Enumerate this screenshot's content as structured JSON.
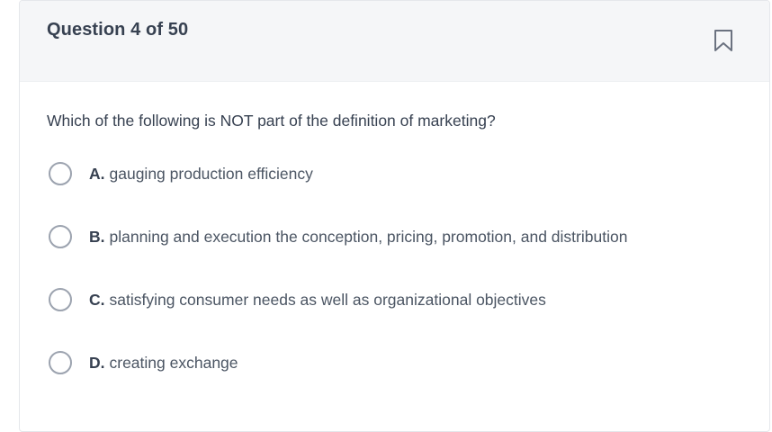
{
  "header": {
    "question_counter": "Question 4 of 50",
    "bookmark_icon": "bookmark-icon"
  },
  "question": {
    "text": "Which of the following is NOT part of the definition of marketing?"
  },
  "options": [
    {
      "letter": "A.",
      "text": "gauging production efficiency"
    },
    {
      "letter": "B.",
      "text": "planning and execution the conception, pricing, promotion, and distribution"
    },
    {
      "letter": "C.",
      "text": "satisfying consumer needs as well as organizational objectives"
    },
    {
      "letter": "D.",
      "text": "creating exchange"
    }
  ],
  "colors": {
    "header_bg": "#f5f6f8",
    "text": "#374151",
    "radio_border": "#9ca3af",
    "bookmark": "#6b7280"
  }
}
